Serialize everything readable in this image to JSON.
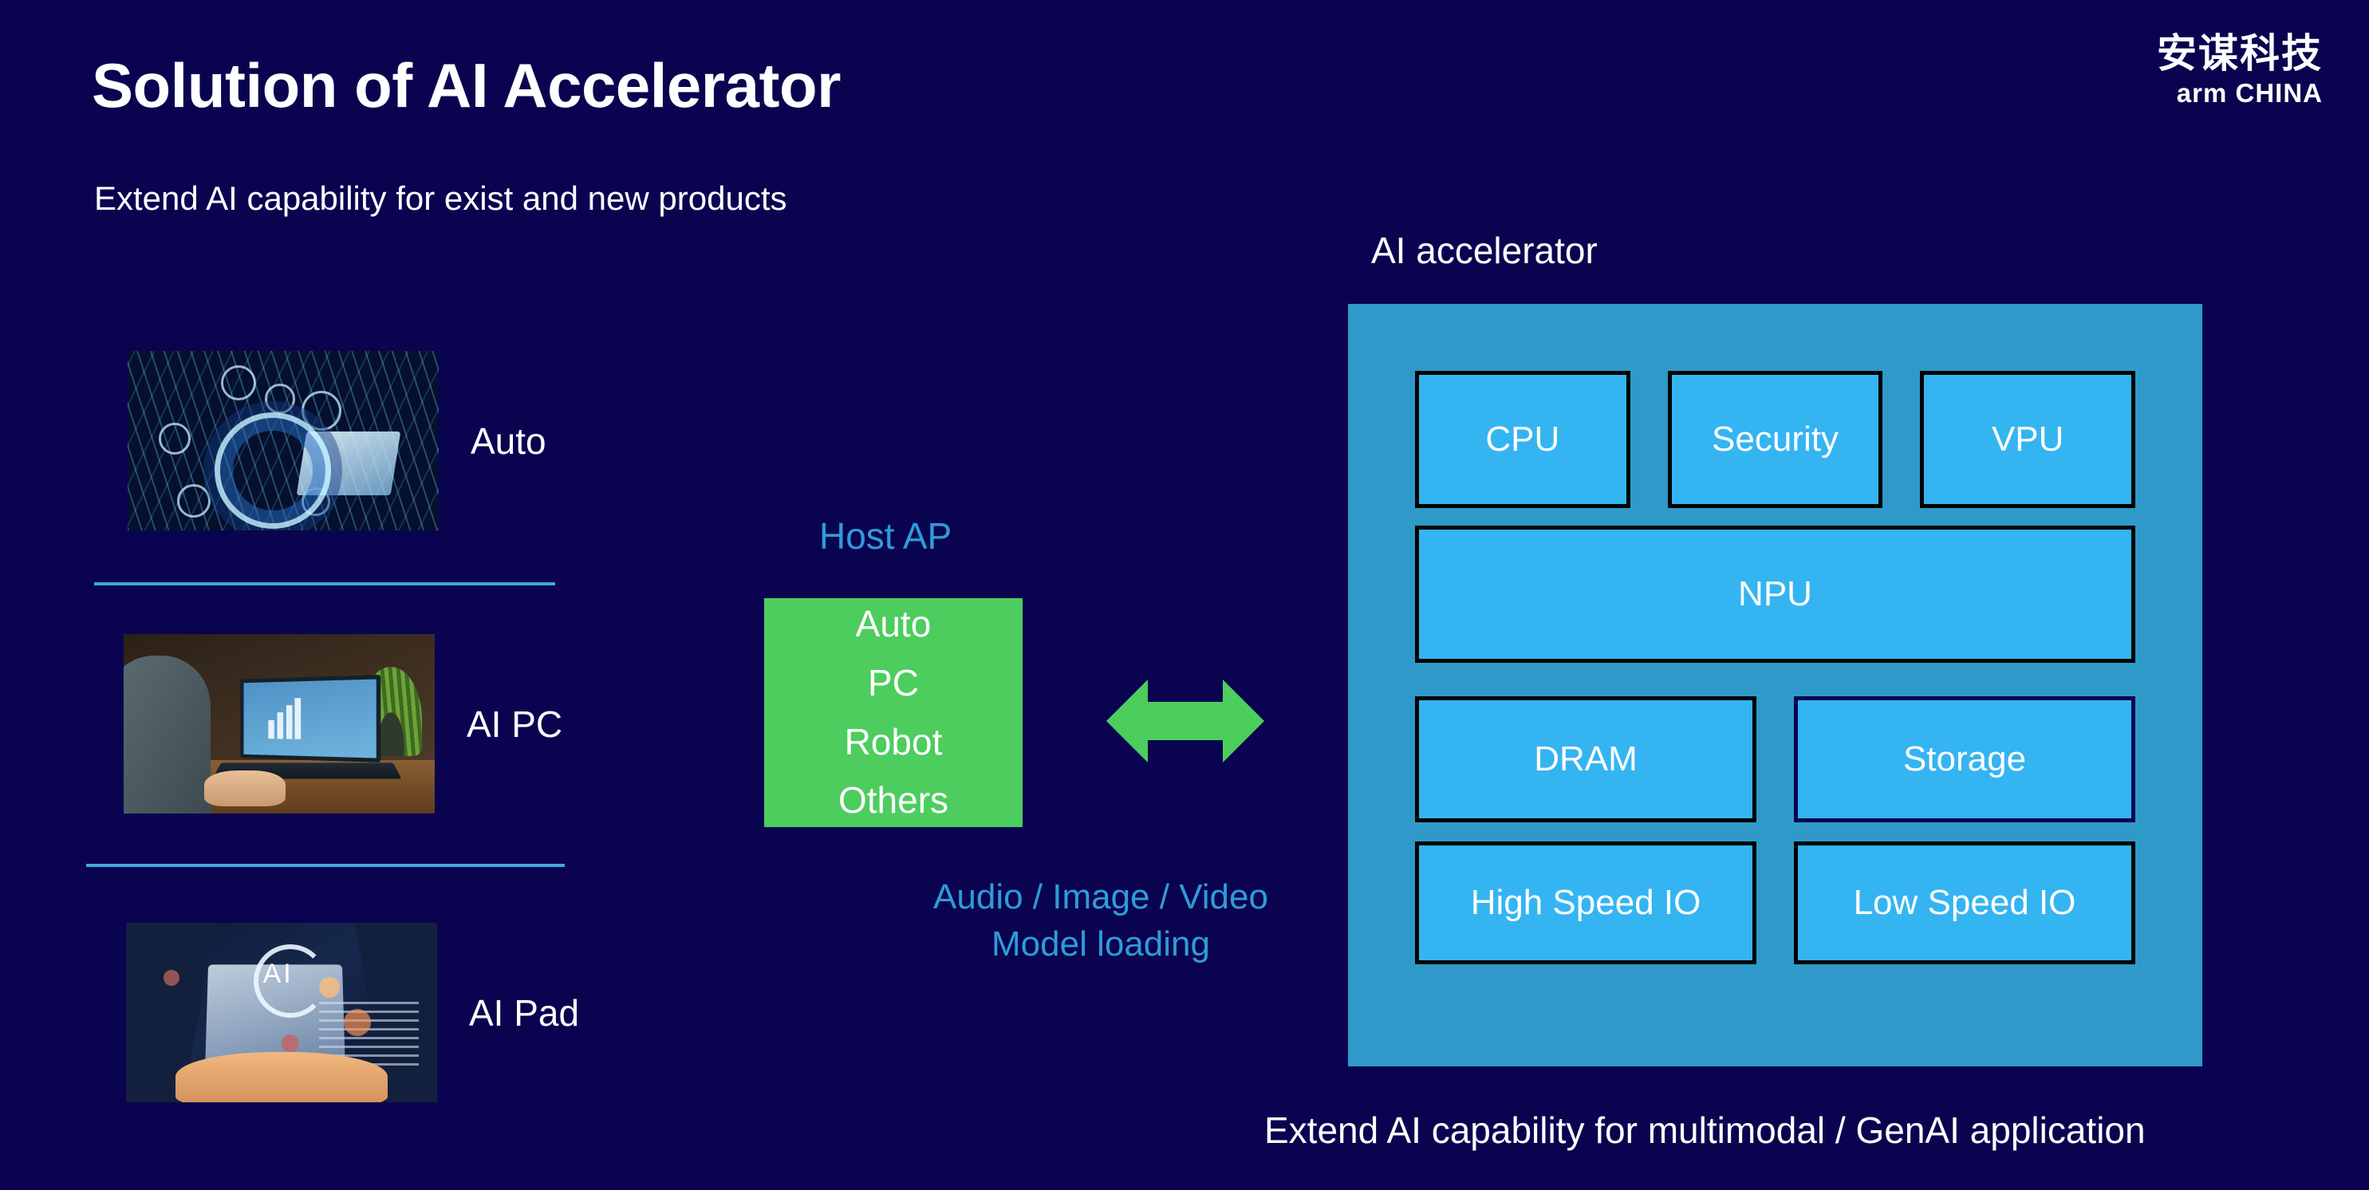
{
  "slide": {
    "title": "Solution of AI Accelerator",
    "subtitle": "Extend AI capability for exist and new products",
    "background_color": "#0a0450"
  },
  "logo": {
    "chinese": "安谋科技",
    "english": "arm CHINA"
  },
  "products": [
    {
      "label": "Auto",
      "image_alt": "car-interior-hud"
    },
    {
      "label": "AI PC",
      "image_alt": "laptop-analytics-desk"
    },
    {
      "label": "AI Pad",
      "image_alt": "hands-holding-tablet-ai"
    }
  ],
  "center": {
    "host_ap_label": "Host AP",
    "host_ap_items": [
      "Auto",
      "PC",
      "Robot",
      "Others"
    ],
    "host_ap_color": "#4ccd5e",
    "arrow_color": "#4ccd5e",
    "caption_line1": "Audio / Image / Video",
    "caption_line2": "Model loading",
    "caption_color": "#2f9bd8"
  },
  "accelerator": {
    "label": "AI accelerator",
    "container_color": "#2f9ac9",
    "box_color": "#35b4f2",
    "rows": [
      {
        "boxes": [
          "CPU",
          "Security",
          "VPU"
        ]
      },
      {
        "boxes": [
          "NPU"
        ]
      },
      {
        "boxes": [
          "DRAM",
          "Storage"
        ]
      },
      {
        "boxes": [
          "High Speed IO",
          "Low Speed IO"
        ]
      }
    ],
    "bottom_caption": "Extend AI capability for multimodal / GenAI application"
  }
}
